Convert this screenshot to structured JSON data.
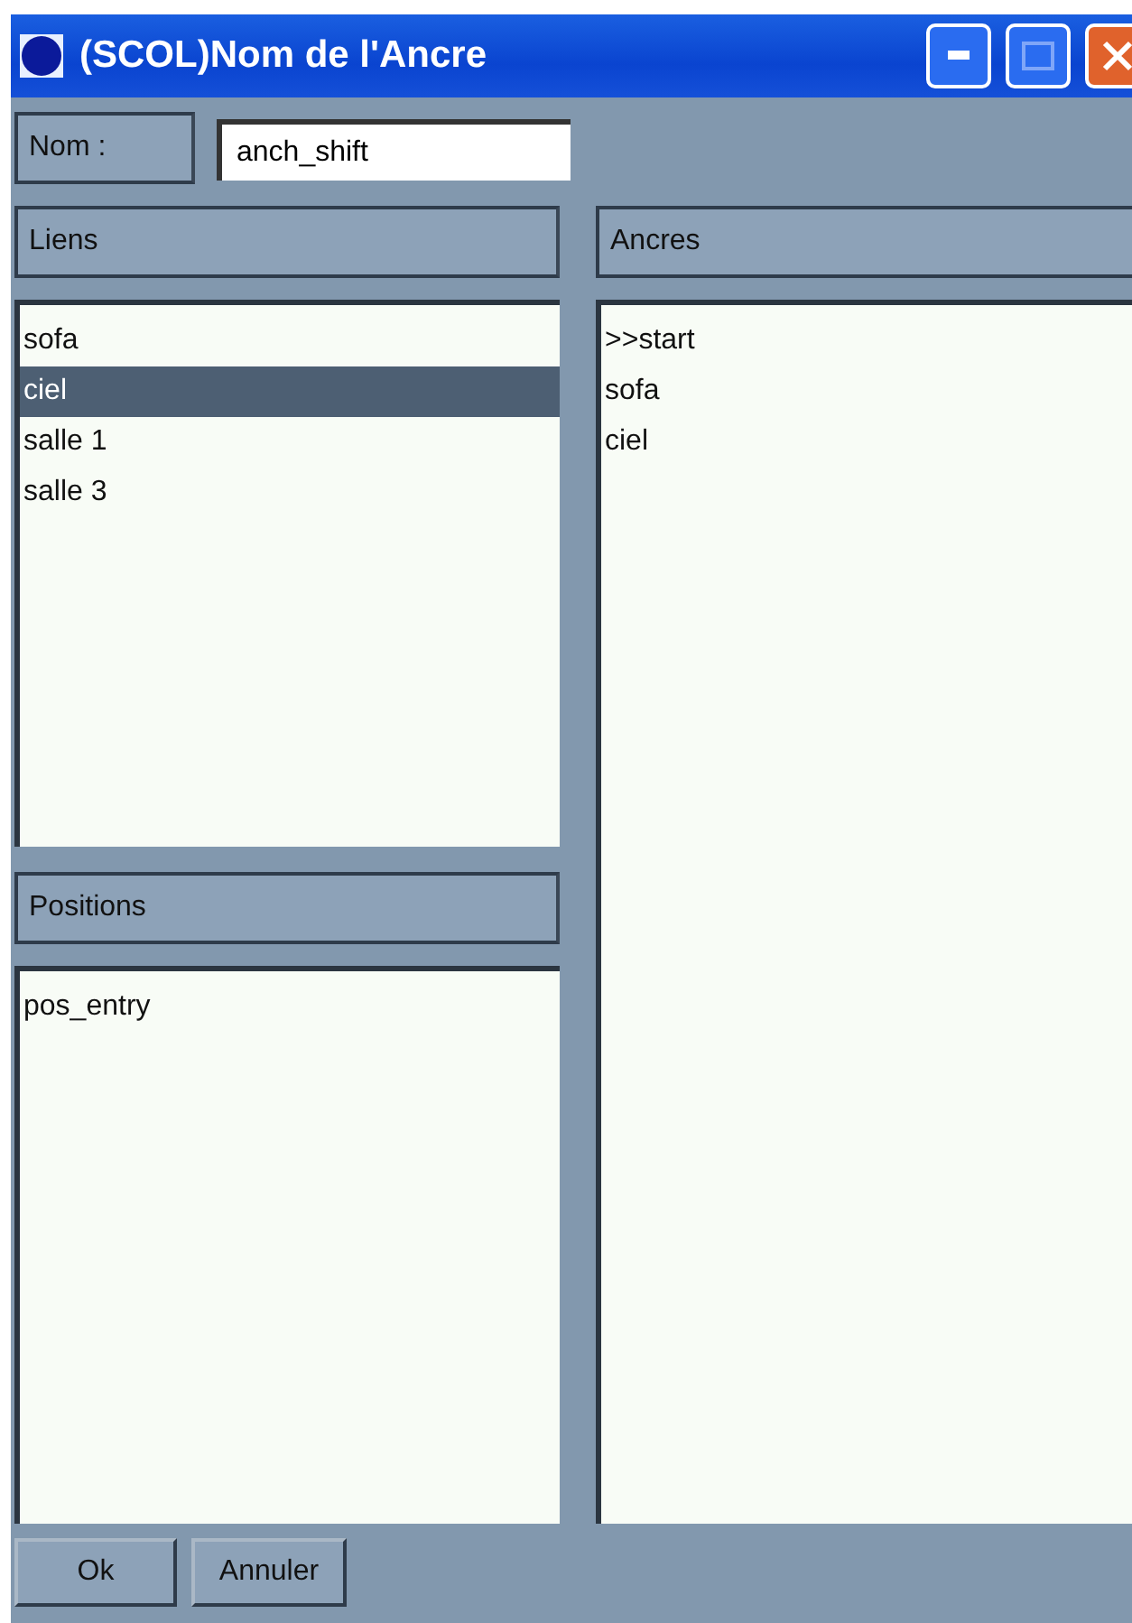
{
  "window": {
    "title": "(SCOL)Nom de l'Ancre"
  },
  "name_field": {
    "label": "Nom :",
    "value": "anch_shift"
  },
  "links": {
    "header": "Liens",
    "items": [
      {
        "label": "sofa",
        "selected": false
      },
      {
        "label": "ciel",
        "selected": true
      },
      {
        "label": "salle 1",
        "selected": false
      },
      {
        "label": "salle 3",
        "selected": false
      }
    ]
  },
  "positions": {
    "header": "Positions",
    "items": [
      {
        "label": "pos_entry",
        "selected": false
      }
    ]
  },
  "anchors": {
    "header": "Ancres",
    "items": [
      {
        "label": ">>start",
        "selected": false
      },
      {
        "label": "sofa",
        "selected": false
      },
      {
        "label": "ciel",
        "selected": false
      }
    ]
  },
  "buttons": [
    "Ok",
    "Annuler"
  ]
}
